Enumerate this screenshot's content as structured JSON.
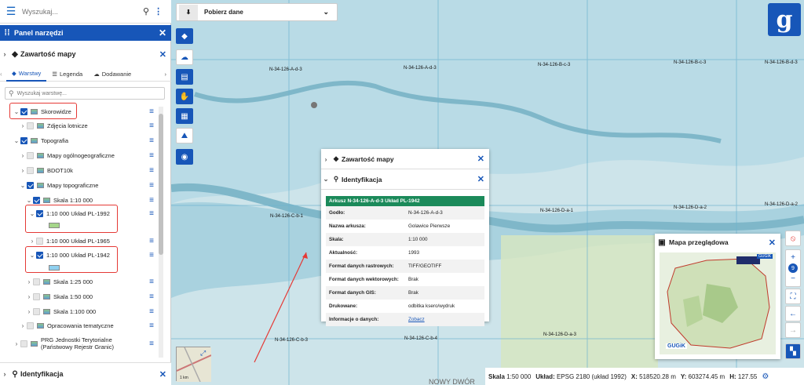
{
  "search": {
    "placeholder": "Wyszukaj..."
  },
  "tools_panel": {
    "title": "Panel narzędzi"
  },
  "content_panel": {
    "title": "Zawartość mapy"
  },
  "tabs": [
    {
      "label": "Warstwy"
    },
    {
      "label": "Legenda"
    },
    {
      "label": "Dodawanie"
    }
  ],
  "layer_search": {
    "placeholder": "Wyszukaj warstwę..."
  },
  "layers": [
    {
      "label": "Skorowidze"
    },
    {
      "label": "Zdjęcia lotnicze"
    },
    {
      "label": "Topografia"
    },
    {
      "label": "Mapy ogólnogeograficzne"
    },
    {
      "label": "BDOT10k"
    },
    {
      "label": "Mapy topograficzne"
    },
    {
      "label": "Skala 1:10 000"
    },
    {
      "label": "1:10 000 Układ PL-1992"
    },
    {
      "label": "1:10 000 Układ PL-1965"
    },
    {
      "label": "1:10 000 Układ PL-1942"
    },
    {
      "label": "Skala 1:25 000"
    },
    {
      "label": "Skala 1:50 000"
    },
    {
      "label": "Skala 1:100 000"
    },
    {
      "label": "Opracowania tematyczne"
    },
    {
      "label": "PRG Jednostki Terytorialne"
    },
    {
      "label": "(Państwowy Rejestr Granic)"
    }
  ],
  "ident_bar": {
    "title": "Identyfikacja"
  },
  "download": {
    "label": "Pobierz dane"
  },
  "popup": {
    "content_title": "Zawartość mapy",
    "ident_title": "Identyfikacja",
    "sheet_title": "Arkusz N-34-126-A-d-3 Układ PL-1942",
    "rows": [
      {
        "k": "Godło:",
        "v": "N-34-126-A-d-3"
      },
      {
        "k": "Nazwa arkusza:",
        "v": "Golawice Pierwsze"
      },
      {
        "k": "Skala:",
        "v": "1:10 000"
      },
      {
        "k": "Aktualność:",
        "v": "1993"
      },
      {
        "k": "Format danych rastrowych:",
        "v": "TIFF/GEOTIFF"
      },
      {
        "k": "Format danych wektorowych:",
        "v": "Brak"
      },
      {
        "k": "Format danych GIS:",
        "v": "Brak"
      },
      {
        "k": "Drukowane:",
        "v": "odbitka ksero/wydruk"
      },
      {
        "k": "Informacje o danych:",
        "v": "Zobacz"
      }
    ]
  },
  "map_labels": [
    "N-34-126-A-d-3",
    "N-34-126-B-c-3",
    "N-34-126-B-d-3",
    "N-34-126-C-b-1",
    "N-34-126-D-a-1",
    "N-34-126-D-a-2",
    "N-34-126-C-b-3",
    "N-34-126-C-b-4",
    "N-34-126-D-a-3",
    "NOWY DWÓR"
  ],
  "overview": {
    "title": "Mapa przeglądowa",
    "badge": "GUGIK"
  },
  "zoom_level": "9",
  "status": {
    "scale_label": "Skala",
    "scale_value": "1:50 000",
    "crs_label": "Układ:",
    "crs_value": "EPSG 2180 (układ 1992)",
    "x_label": "X:",
    "x_value": "518520.28 m",
    "y_label": "Y:",
    "y_value": "603274.45 m",
    "h_label": "H:",
    "h_value": "127.55"
  },
  "minimap": {
    "scale": "1 km"
  },
  "colors": {
    "accent": "#1756b8",
    "highlight": "#e53935",
    "table_header": "#1b8a5a"
  }
}
